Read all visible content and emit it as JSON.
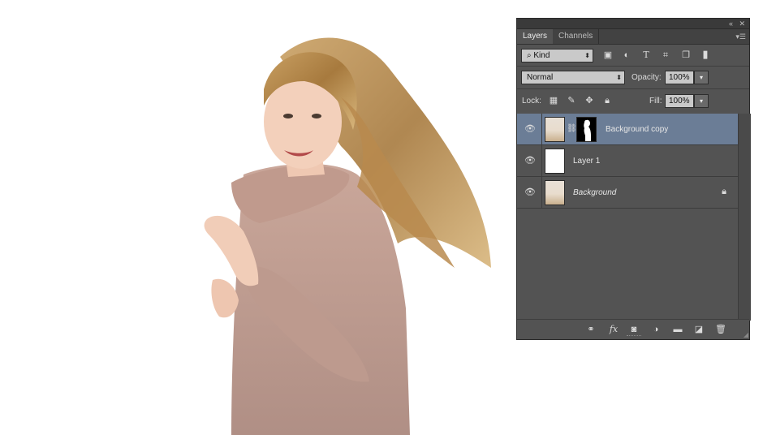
{
  "panel": {
    "collapse_icon": "double-chevron-icon",
    "close_icon": "close-icon",
    "menu_icon": "panel-menu-icon",
    "tabs": [
      {
        "label": "Layers",
        "active": true
      },
      {
        "label": "Channels",
        "active": false
      }
    ],
    "filter": {
      "kind_label": "Kind",
      "icons": [
        "image-filter-icon",
        "adjustment-filter-icon",
        "type-filter-icon",
        "shape-filter-icon",
        "smart-object-filter-icon",
        "filter-toggle-icon"
      ]
    },
    "blend": {
      "mode": "Normal",
      "opacity_label": "Opacity:",
      "opacity_value": "100%"
    },
    "lock": {
      "label": "Lock:",
      "icons": [
        "lock-transparent-pixels-icon",
        "lock-image-pixels-icon",
        "lock-position-icon",
        "lock-all-icon"
      ],
      "fill_label": "Fill:",
      "fill_value": "100%"
    },
    "layers": [
      {
        "name": "Background copy",
        "selected": true,
        "has_mask": true,
        "thumb": "photo",
        "italic": false,
        "locked": false
      },
      {
        "name": "Layer 1",
        "selected": false,
        "has_mask": false,
        "thumb": "white",
        "italic": false,
        "locked": false
      },
      {
        "name": "Background",
        "selected": false,
        "has_mask": false,
        "thumb": "photo",
        "italic": true,
        "locked": true
      }
    ],
    "bottom_icons": [
      "link-layers-icon",
      "fx-icon",
      "add-mask-icon",
      "adjustment-layer-icon",
      "new-group-icon",
      "new-layer-icon",
      "trash-icon"
    ],
    "bottom_fx_label": "fx"
  },
  "colors": {
    "panel_bg": "#535353",
    "selected_row": "#6b7d96",
    "field_bg": "#c9c9c9"
  }
}
